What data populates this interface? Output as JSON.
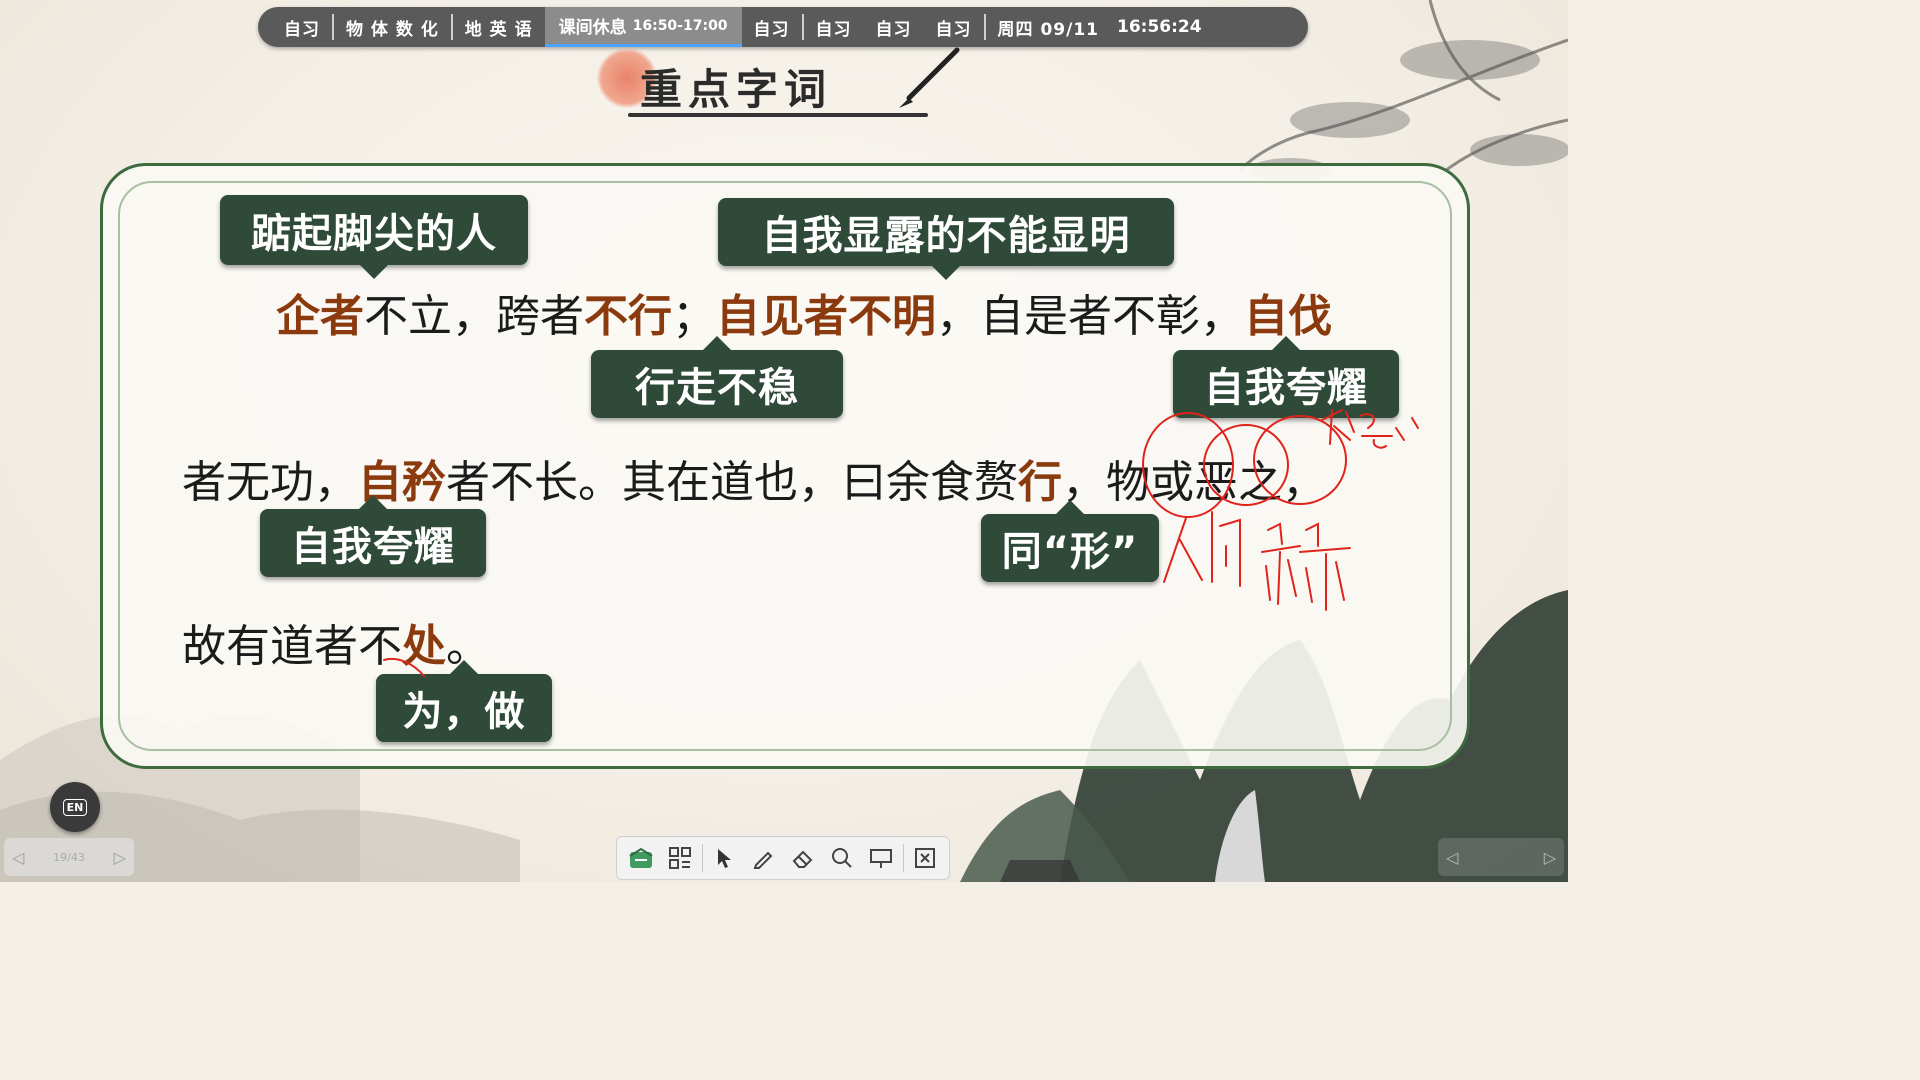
{
  "schedule": {
    "items": [
      "自习",
      "物 体 数 化",
      "地 英 语"
    ],
    "current": {
      "label": "课间休息",
      "time": "16:50-17:00"
    },
    "after": [
      "自习",
      "自习",
      "自习",
      "自习"
    ],
    "date": "周四 09/11",
    "clock": "16:56:24"
  },
  "title": "重点字词",
  "passage": {
    "line1": {
      "p1": "企者",
      "p2": "不立，跨者",
      "p3": "不行",
      "p4": "；",
      "p5": "自见者不明",
      "p6": "，自是者不彰，",
      "p7": "自伐"
    },
    "line2": {
      "p1": "者无功，",
      "p2": "自矜",
      "p3": "者不长。其在道也，曰余食赘",
      "p4": "行",
      "p5": "，物或恶之，"
    },
    "line3": {
      "p1": "故有道者不",
      "p2": "处",
      "p3": "。"
    }
  },
  "labels": {
    "qizhe": "踮起脚尖的人",
    "zijian": "自我显露的不能显明",
    "buxing": "行走不稳",
    "zifa": "自我夸耀",
    "zijin": "自我夸耀",
    "xing": "同“形”",
    "chu": "为，做"
  },
  "annotation_color": "#e0241b",
  "toolbar": {
    "icons": [
      "whiteboard-icon",
      "grid-icon",
      "pointer-icon",
      "pen-icon",
      "eraser-icon",
      "search-icon",
      "present-icon",
      "exit-icon"
    ]
  },
  "lang_badge": "EN",
  "pager": {
    "count": "19/43"
  }
}
